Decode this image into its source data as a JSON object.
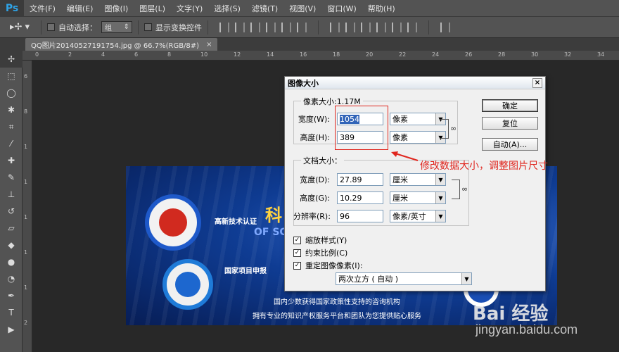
{
  "app": {
    "logo": "Ps"
  },
  "menu": [
    "文件(F)",
    "编辑(E)",
    "图像(I)",
    "图层(L)",
    "文字(Y)",
    "选择(S)",
    "滤镜(T)",
    "视图(V)",
    "窗口(W)",
    "帮助(H)"
  ],
  "options_bar": {
    "auto_select_label": "自动选择：",
    "auto_select_value": "组",
    "show_transform_label": "显示变换控件"
  },
  "document_tab": {
    "title": "QQ图片20140527191754.jpg @ 66.7%(RGB/8#)",
    "close": "×"
  },
  "ruler": {
    "top": [
      "0",
      "2",
      "4",
      "6",
      "8",
      "10",
      "12",
      "14",
      "16",
      "18",
      "20",
      "22",
      "24",
      "26",
      "28",
      "30",
      "32",
      "34"
    ],
    "left": [
      "6",
      "8",
      "1",
      "1",
      "1",
      "1",
      "1",
      "2"
    ]
  },
  "canvas_image": {
    "title": "科",
    "subtitle": "OF SC",
    "badge1_text": "高新技术认证",
    "badge2_text": "国家项目申报",
    "line1": "国内少数获得国家政策性支持的咨询机构",
    "line2": "拥有专业的知识产权服务平台和团队为您提供贴心服务"
  },
  "dialog": {
    "title": "图像大小",
    "close": "×",
    "pixel_group": {
      "legend": "像素大小:1.17M",
      "width_label": "宽度(W):",
      "width_value": "1054",
      "width_unit": "像素",
      "height_label": "高度(H):",
      "height_value": "389",
      "height_unit": "像素"
    },
    "doc_group": {
      "legend": "文档大小：",
      "width_label": "宽度(D):",
      "width_value": "27.89",
      "width_unit": "厘米",
      "height_label": "高度(G):",
      "height_value": "10.29",
      "height_unit": "厘米",
      "resolution_label": "分辨率(R):",
      "resolution_value": "96",
      "resolution_unit": "像素/英寸"
    },
    "checkboxes": [
      {
        "label": "缩放样式(Y)",
        "checked": true
      },
      {
        "label": "约束比例(C)",
        "checked": true
      },
      {
        "label": "重定图像像素(I):",
        "checked": true
      }
    ],
    "resample_value": "两次立方 ( 自动 )",
    "buttons": {
      "ok": "确定",
      "reset": "复位",
      "auto": "自动(A)..."
    }
  },
  "annotation": {
    "text": "修改数据大小，调整图片尺寸",
    "color": "#e0261e"
  },
  "watermark": {
    "logo": "Bai 经验",
    "url": "jingyan.baidu.com"
  }
}
